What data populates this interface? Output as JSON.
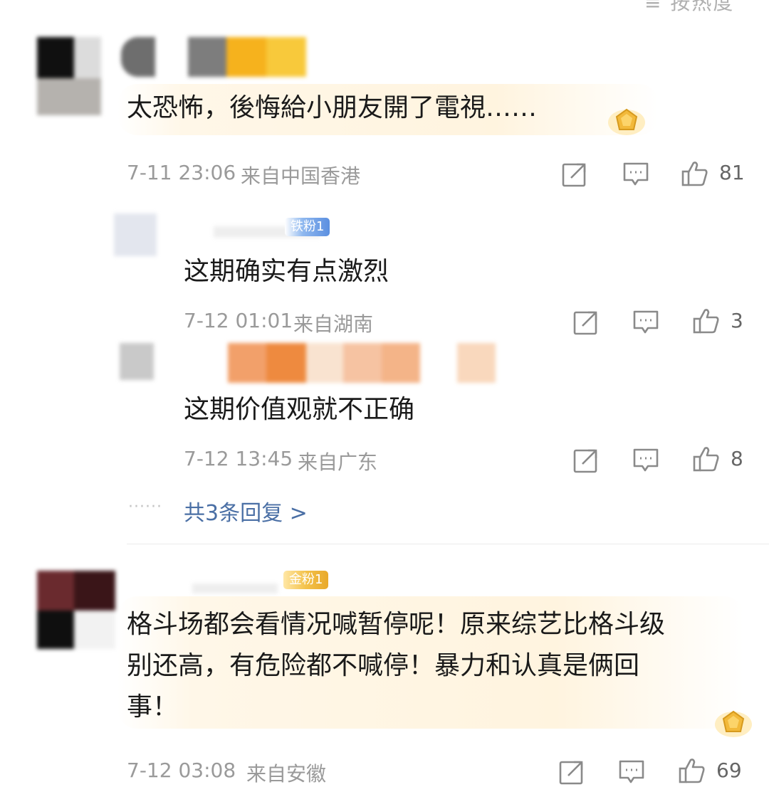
{
  "header": {
    "sort_label": "≡ 按热度"
  },
  "colors": {
    "accent_link": "#4a6fa5",
    "meta_gray": "#9a9a9a",
    "badge_gold": "#f3c24b",
    "badge_blue": "#5b8fe0"
  },
  "comments": [
    {
      "text": "太恐怖，後悔給小朋友開了電視……",
      "time": "7-11 23:06",
      "location": "来自中国香港",
      "likes": "81",
      "replies": [
        {
          "badge": "铁粉1",
          "text": "这期确实有点激烈",
          "time": "7-12 01:01",
          "location": "来自湖南",
          "likes": "3"
        },
        {
          "text": "这期价值观就不正确",
          "time": "7-12 13:45",
          "location": "来自广东",
          "likes": "8"
        }
      ],
      "more_replies_label": "共3条回复 >"
    },
    {
      "badge": "金粉1",
      "lines": [
        "格斗场都会看情况喊暂停呢！原来综艺比格斗级",
        "别还高，有危险都不喊停！暴力和认真是俩回",
        "事！"
      ],
      "time": "7-12 03:08",
      "location": "来自安徽",
      "likes": "69"
    }
  ],
  "icons": [
    "share-icon",
    "comment-icon",
    "like-icon",
    "medal-icon"
  ]
}
